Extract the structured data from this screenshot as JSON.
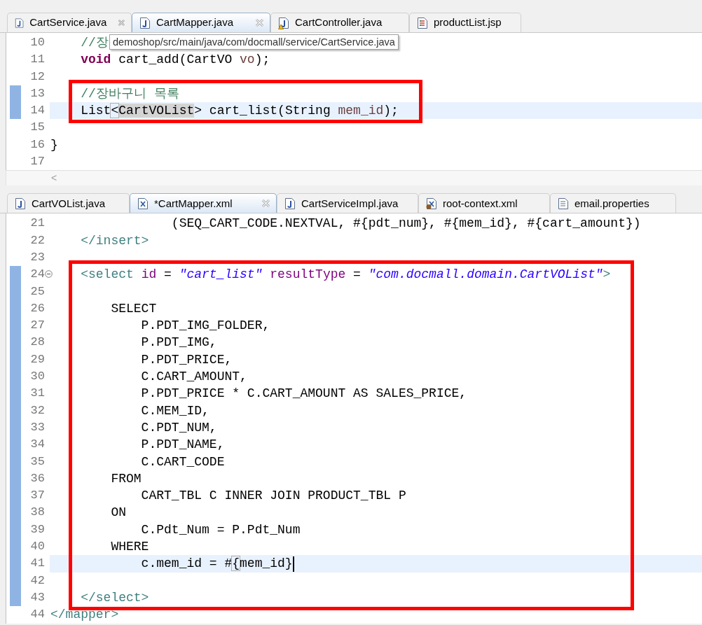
{
  "editors": [
    {
      "tabs": [
        {
          "label": "CartService.java",
          "kind": "java",
          "closable": true,
          "selected": false
        },
        {
          "label": "CartMapper.java",
          "kind": "java",
          "closable": true,
          "selected": true
        },
        {
          "label": "CartController.java",
          "kind": "java-warning",
          "closable": false,
          "selected": false
        },
        {
          "label": "productList.jsp",
          "kind": "jsp",
          "closable": false,
          "selected": false
        }
      ],
      "tooltip": "demoshop/src/main/java/com/docmall/service/CartService.java",
      "h_scroll_arrow": "<",
      "blocks": [
        {
          "boxed": false,
          "lines": [
            {
              "number": "10",
              "changed": false,
              "current": false,
              "segments": [
                {
                  "kind": "comment",
                  "text": "    //장"
                }
              ]
            },
            {
              "number": "11",
              "changed": false,
              "current": false,
              "segments": [
                {
                  "kind": "keyword",
                  "text": "    void"
                },
                {
                  "kind": "plain",
                  "text": " cart_add(CartVO "
                },
                {
                  "kind": "param",
                  "text": "vo"
                },
                {
                  "kind": "plain",
                  "text": ");"
                }
              ]
            },
            {
              "number": "12",
              "changed": false,
              "current": false
            }
          ]
        },
        {
          "boxed": true,
          "lines": [
            {
              "number": "13",
              "changed": true,
              "current": false,
              "segments": [
                {
                  "kind": "comment",
                  "text": "    //장바구니 목록"
                }
              ]
            },
            {
              "number": "14",
              "changed": true,
              "current": true,
              "segments": [
                {
                  "kind": "plain",
                  "text": "    List"
                },
                {
                  "kind": "bracket",
                  "text": "<"
                },
                {
                  "kind": "occurrence",
                  "text": "CartVOList"
                },
                {
                  "kind": "plain",
                  "text": "> cart_list(String "
                },
                {
                  "kind": "param",
                  "text": "mem_id"
                },
                {
                  "kind": "plain",
                  "text": ");"
                }
              ]
            }
          ]
        },
        {
          "boxed": false,
          "lines": [
            {
              "number": "15",
              "changed": false,
              "current": false
            },
            {
              "number": "16",
              "changed": false,
              "current": false,
              "segments": [
                {
                  "kind": "plain",
                  "text": "}"
                }
              ]
            },
            {
              "number": "17",
              "changed": false,
              "current": false
            }
          ]
        }
      ]
    },
    {
      "tabs": [
        {
          "label": "CartVOList.java",
          "kind": "java",
          "closable": false,
          "selected": false
        },
        {
          "label": "*CartMapper.xml",
          "kind": "xml",
          "closable": true,
          "selected": true
        },
        {
          "label": "CartServiceImpl.java",
          "kind": "java",
          "closable": false,
          "selected": false
        },
        {
          "label": "root-context.xml",
          "kind": "xml-bean",
          "closable": false,
          "selected": false
        },
        {
          "label": "email.properties",
          "kind": "properties",
          "closable": false,
          "selected": false
        }
      ],
      "blocks": [
        {
          "boxed": false,
          "lines": [
            {
              "number": "21",
              "changed": false,
              "current": false,
              "segments": [
                {
                  "kind": "plain",
                  "text": "                (SEQ_CART_CODE.NEXTVAL, #{pdt_num}, #{mem_id}, #{cart_amount})"
                }
              ]
            },
            {
              "number": "22",
              "changed": false,
              "current": false,
              "segments": [
                {
                  "kind": "tag",
                  "text": "    </insert>"
                }
              ]
            },
            {
              "number": "23",
              "changed": false,
              "current": false
            }
          ]
        },
        {
          "boxed": true,
          "lines": [
            {
              "number": "24",
              "changed": true,
              "current": false,
              "foldable": true,
              "segments": [
                {
                  "kind": "tag",
                  "text": "    <select"
                },
                {
                  "kind": "attr",
                  "text": " id"
                },
                {
                  "kind": "plain",
                  "text": " = "
                },
                {
                  "kind": "string",
                  "text": "\"cart_list\""
                },
                {
                  "kind": "attr",
                  "text": " resultType"
                },
                {
                  "kind": "plain",
                  "text": " = "
                },
                {
                  "kind": "string",
                  "text": "\"com.docmall.domain.CartVOList\""
                },
                {
                  "kind": "tag",
                  "text": ">"
                }
              ]
            },
            {
              "number": "25",
              "changed": true,
              "current": false
            },
            {
              "number": "26",
              "changed": true,
              "current": false,
              "segments": [
                {
                  "kind": "plain",
                  "text": "        SELECT"
                }
              ]
            },
            {
              "number": "27",
              "changed": true,
              "current": false,
              "segments": [
                {
                  "kind": "plain",
                  "text": "            P.PDT_IMG_FOLDER,"
                }
              ]
            },
            {
              "number": "28",
              "changed": true,
              "current": false,
              "segments": [
                {
                  "kind": "plain",
                  "text": "            P.PDT_IMG,"
                }
              ]
            },
            {
              "number": "29",
              "changed": true,
              "current": false,
              "segments": [
                {
                  "kind": "plain",
                  "text": "            P.PDT_PRICE,"
                }
              ]
            },
            {
              "number": "30",
              "changed": true,
              "current": false,
              "segments": [
                {
                  "kind": "plain",
                  "text": "            C.CART_AMOUNT,"
                }
              ]
            },
            {
              "number": "31",
              "changed": true,
              "current": false,
              "segments": [
                {
                  "kind": "plain",
                  "text": "            P.PDT_PRICE * C.CART_AMOUNT AS SALES_PRICE,"
                }
              ]
            },
            {
              "number": "32",
              "changed": true,
              "current": false,
              "segments": [
                {
                  "kind": "plain",
                  "text": "            C.MEM_ID,"
                }
              ]
            },
            {
              "number": "33",
              "changed": true,
              "current": false,
              "segments": [
                {
                  "kind": "plain",
                  "text": "            C.PDT_NUM,"
                }
              ]
            },
            {
              "number": "34",
              "changed": true,
              "current": false,
              "segments": [
                {
                  "kind": "plain",
                  "text": "            P.PDT_NAME,"
                }
              ]
            },
            {
              "number": "35",
              "changed": true,
              "current": false,
              "segments": [
                {
                  "kind": "plain",
                  "text": "            C.CART_CODE"
                }
              ]
            },
            {
              "number": "36",
              "changed": true,
              "current": false,
              "segments": [
                {
                  "kind": "plain",
                  "text": "        FROM"
                }
              ]
            },
            {
              "number": "37",
              "changed": true,
              "current": false,
              "segments": [
                {
                  "kind": "plain",
                  "text": "            CART_TBL C INNER JOIN PRODUCT_TBL P"
                }
              ]
            },
            {
              "number": "38",
              "changed": true,
              "current": false,
              "segments": [
                {
                  "kind": "plain",
                  "text": "        ON"
                }
              ]
            },
            {
              "number": "39",
              "changed": true,
              "current": false,
              "segments": [
                {
                  "kind": "plain",
                  "text": "            C.Pdt_Num = P.Pdt_Num"
                }
              ]
            },
            {
              "number": "40",
              "changed": true,
              "current": false,
              "segments": [
                {
                  "kind": "plain",
                  "text": "        WHERE"
                }
              ]
            },
            {
              "number": "41",
              "changed": true,
              "current": true,
              "cursor": true,
              "segments": [
                {
                  "kind": "plain",
                  "text": "            c.mem_id = #"
                },
                {
                  "kind": "bracket",
                  "text": "{"
                },
                {
                  "kind": "plain",
                  "text": "mem_id}"
                }
              ]
            },
            {
              "number": "42",
              "changed": true,
              "current": false
            },
            {
              "number": "43",
              "changed": true,
              "current": false,
              "segments": [
                {
                  "kind": "tag",
                  "text": "    </select>"
                }
              ]
            }
          ]
        },
        {
          "boxed": false,
          "lines": [
            {
              "number": "44",
              "changed": false,
              "current": false,
              "segments": [
                {
                  "kind": "tag",
                  "text": "</mapper>"
                }
              ]
            }
          ]
        }
      ]
    }
  ]
}
